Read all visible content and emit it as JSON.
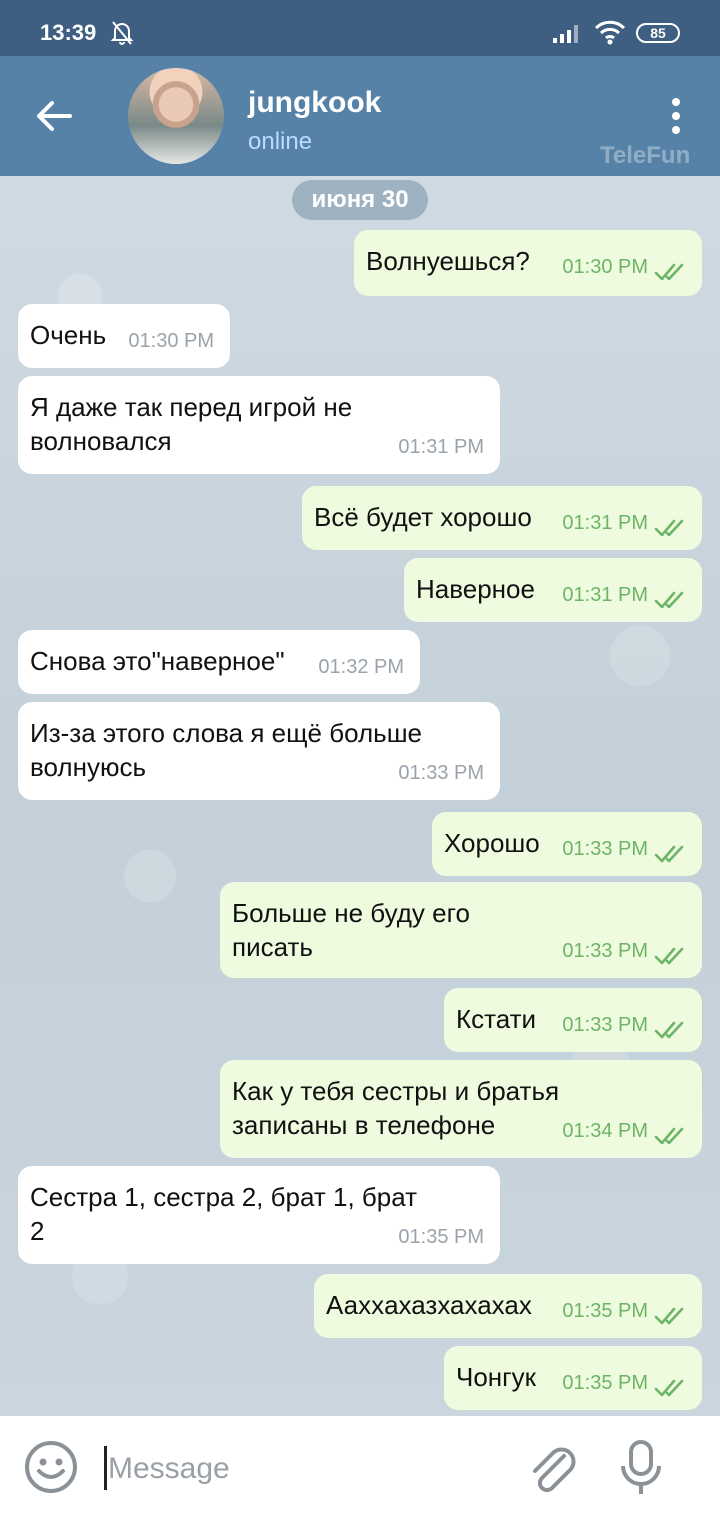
{
  "status_bar": {
    "time": "13:39",
    "battery": "85"
  },
  "header": {
    "contact_name": "jungkook",
    "contact_status": "online",
    "watermark": "TeleFun"
  },
  "chat": {
    "date": "июня 30",
    "messages": [
      {
        "dir": "out",
        "lines": [
          "Волнуешься?"
        ],
        "time": "01:30 PM"
      },
      {
        "dir": "in",
        "lines": [
          "Очень"
        ],
        "time": "01:30 PM"
      },
      {
        "dir": "in",
        "lines": [
          "Я даже так перед игрой не",
          "волновался"
        ],
        "time": "01:31 PM"
      },
      {
        "dir": "out",
        "lines": [
          "Всё будет хорошо"
        ],
        "time": "01:31 PM"
      },
      {
        "dir": "out",
        "lines": [
          "Наверное"
        ],
        "time": "01:31 PM"
      },
      {
        "dir": "in",
        "lines": [
          "Снова это\"наверное\""
        ],
        "time": "01:32 PM"
      },
      {
        "dir": "in",
        "lines": [
          "Из-за этого слова я ещё больше",
          "волнуюсь"
        ],
        "time": "01:33 PM"
      },
      {
        "dir": "out",
        "lines": [
          "Хорошо"
        ],
        "time": "01:33 PM"
      },
      {
        "dir": "out",
        "lines": [
          "Больше не буду его",
          "писать"
        ],
        "time": "01:33 PM"
      },
      {
        "dir": "out",
        "lines": [
          "Кстати"
        ],
        "time": "01:33 PM"
      },
      {
        "dir": "out",
        "lines": [
          "Как у тебя сестры и братья",
          "записаны в телефоне"
        ],
        "time": "01:34 PM"
      },
      {
        "dir": "in",
        "lines": [
          "Сестра 1, сестра 2, брат 1, брат",
          "2"
        ],
        "time": "01:35 PM"
      },
      {
        "dir": "out",
        "lines": [
          "Аахxахазхахахах"
        ],
        "time": "01:35 PM"
      },
      {
        "dir": "out",
        "lines": [
          "Чонгук"
        ],
        "time": "01:35 PM"
      }
    ]
  },
  "input": {
    "placeholder": "Message"
  },
  "colors": {
    "header": "#5682a8",
    "status_bar": "#3f5f82",
    "outgoing_bubble": "#effbdf",
    "incoming_bubble": "#ffffff",
    "read_check": "#6db566"
  }
}
